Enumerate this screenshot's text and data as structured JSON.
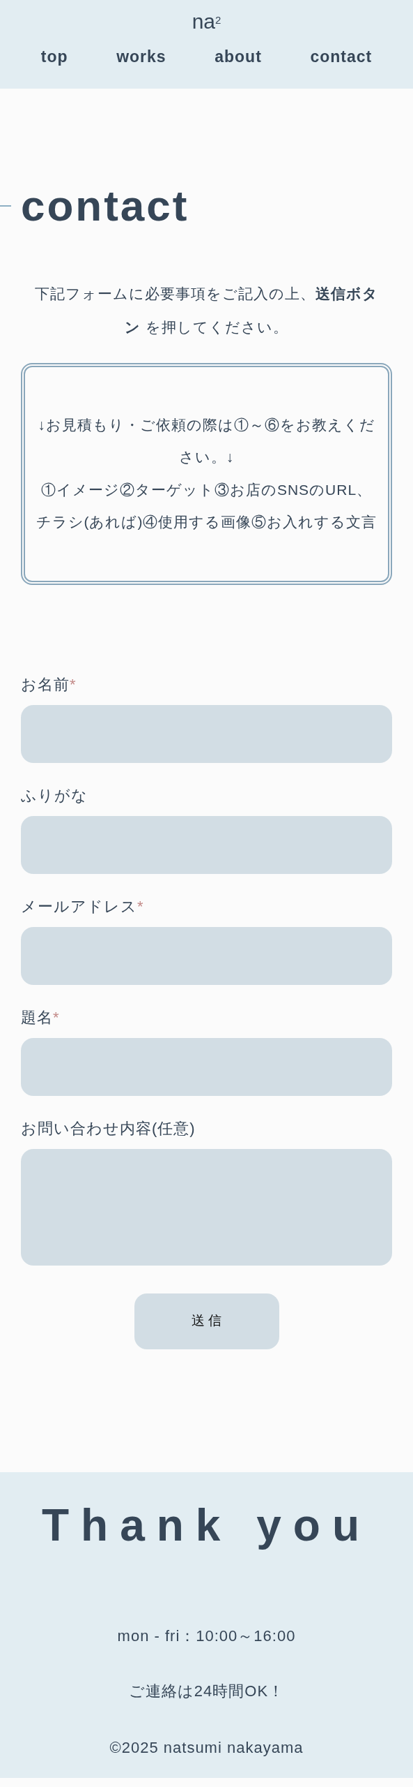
{
  "header": {
    "logo": "na$^{2}$",
    "nav": [
      {
        "label": "top"
      },
      {
        "label": "works"
      },
      {
        "label": "about"
      },
      {
        "label": "contact"
      }
    ]
  },
  "page_title": "contact",
  "intro": "下記フォームに必要事項をご記入の上、**送信ボタン** を押してください。",
  "notice": [
    "↓お見積もり・ご依頼の際は①～⑥をお教えください。↓",
    "①イメージ②ターゲット③お店のSNSのURL、チラシ(あれば)④使用する画像⑤お入れする文言"
  ],
  "form": {
    "fields": [
      {
        "kind": "input",
        "label": "お名前",
        "required_mark": "*"
      },
      {
        "kind": "input",
        "label": "ふりがな"
      },
      {
        "kind": "input",
        "label": "メールアドレス",
        "required_mark": "*"
      },
      {
        "kind": "input",
        "label": "題名",
        "required_mark": "*"
      },
      {
        "kind": "textarea",
        "label": "お問い合わせ内容(任意)"
      }
    ],
    "submit": "送 信"
  },
  "footer": {
    "heading": "Thank you",
    "hours": "mon - fri：10:00～16:00",
    "note": "ご連絡は24時間OK！",
    "copyright": "©2025 natsumi nakayama"
  }
}
